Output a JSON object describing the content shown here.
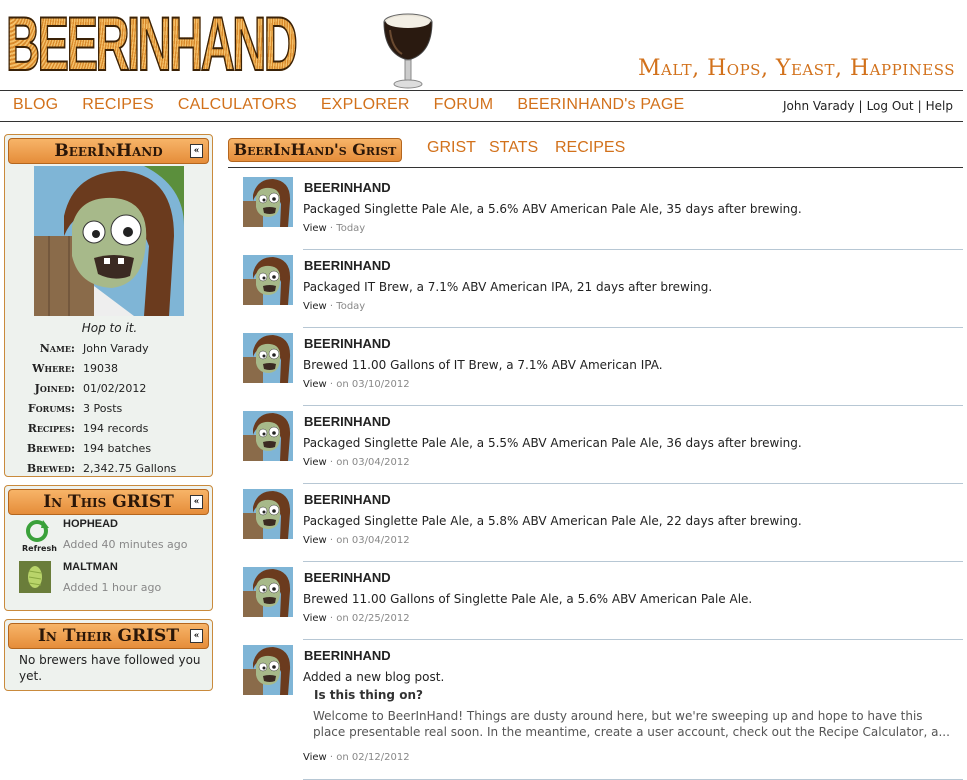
{
  "header": {
    "logo_text": "BEERINHAND",
    "tagline": "Malt, Hops, Yeast, Happiness"
  },
  "nav": {
    "links": [
      "BLOG",
      "RECIPES",
      "CALCULATORS",
      "EXPLORER",
      "FORUM",
      "BEERINHAND's PAGE"
    ],
    "user": "John Varady",
    "logout": "Log Out",
    "help": "Help",
    "separator": "|"
  },
  "profile": {
    "title": "BeerInHand",
    "collapse_glyph": "«",
    "motto": "Hop to it.",
    "fields": [
      {
        "label": "Name:",
        "value": "John Varady"
      },
      {
        "label": "Where:",
        "value": "19038"
      },
      {
        "label": "Joined:",
        "value": "01/02/2012"
      },
      {
        "label": "Forums:",
        "value": "3 Posts"
      },
      {
        "label": "Recipes:",
        "value": "194 records"
      },
      {
        "label": "Brewed:",
        "value": "194 batches"
      },
      {
        "label": "Brewed:",
        "value": "2,342.75 Gallons"
      }
    ]
  },
  "in_grist": {
    "title": "In This GRIST",
    "items": [
      {
        "name": "HOPHEAD",
        "time": "Added 40 minutes ago",
        "thumb_label": "Refresh"
      },
      {
        "name": "MALTMAN",
        "time": "Added 1 hour ago"
      }
    ]
  },
  "their_grist": {
    "title": "In Their GRIST",
    "message": "No brewers have followed you yet."
  },
  "tabs": {
    "active": "BeerInHand's Grist",
    "others": [
      "GRIST",
      "STATS",
      "RECIPES"
    ]
  },
  "feed": [
    {
      "name": "BEERINHAND",
      "text": "Packaged Singlette Pale Ale, a 5.6% ABV American Pale Ale, 35 days after brewing.",
      "view": "View",
      "time": "Today"
    },
    {
      "name": "BEERINHAND",
      "text": "Packaged IT Brew, a 7.1% ABV American IPA, 21 days after brewing.",
      "view": "View",
      "time": "Today"
    },
    {
      "name": "BEERINHAND",
      "text": "Brewed 11.00 Gallons of IT Brew, a 7.1% ABV American IPA.",
      "view": "View",
      "time": "on 03/10/2012"
    },
    {
      "name": "BEERINHAND",
      "text": "Packaged Singlette Pale Ale, a 5.5% ABV American Pale Ale, 36 days after brewing.",
      "view": "View",
      "time": "on 03/04/2012"
    },
    {
      "name": "BEERINHAND",
      "text": "Packaged Singlette Pale Ale, a 5.8% ABV American Pale Ale, 22 days after brewing.",
      "view": "View",
      "time": "on 03/04/2012"
    },
    {
      "name": "BEERINHAND",
      "text": "Brewed 11.00 Gallons of Singlette Pale Ale, a 5.6% ABV American Pale Ale.",
      "view": "View",
      "time": "on 02/25/2012"
    },
    {
      "name": "BEERINHAND",
      "text": "Added a new blog post.",
      "post_title": "Is this thing on?",
      "excerpt": "Welcome to BeerInHand! Things are dusty around here, but we're sweeping up and hope to have this place presentable real soon. In the meantime, create a user account, check out the Recipe Calculator, a...",
      "view": "View",
      "time": "on 02/12/2012"
    }
  ],
  "meta_separator": "·",
  "colors": {
    "accent": "#d2711b",
    "box_bg": "#eef2ee",
    "title_bg": "#e58d3a"
  }
}
